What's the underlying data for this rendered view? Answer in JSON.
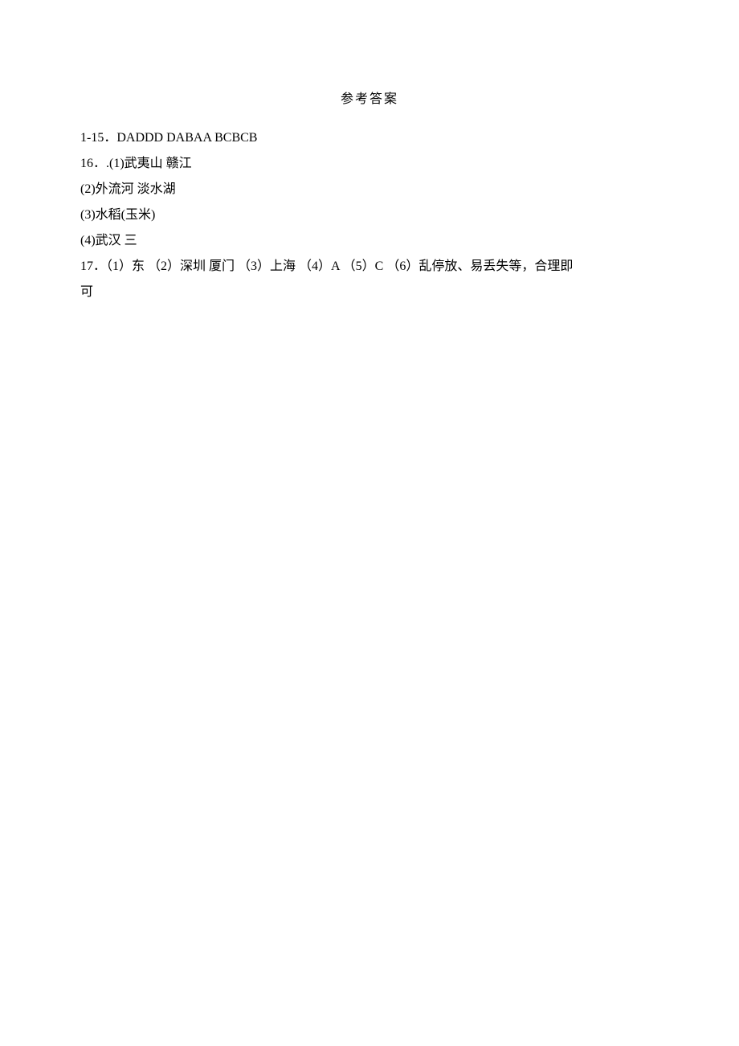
{
  "title": "参考答案",
  "lines": {
    "q1_15": "1-15．DADDD  DABAA  BCBCB",
    "q16_1": "16．.(1)武夷山  赣江",
    "q16_2": "(2)外流河  淡水湖",
    "q16_3": "(3)水稻(玉米)",
    "q16_4": "(4)武汉  三",
    "q17_line1": "17．（1）东  （2）深圳  厦门  （3）上海  （4）A  （5）C  （6）乱停放、易丢失等，合理即",
    "q17_line2": "可"
  }
}
